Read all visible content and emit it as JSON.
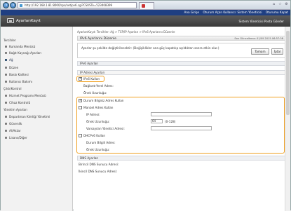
{
  "browser": {
    "url": "http://192.168.1.81:8000/rps/netipv6.cgi?CSUSTo=523408399",
    "back_icon": "back-arrow-icon",
    "forward_icon": "forward-arrow-icon"
  },
  "topmenu": {
    "items": [
      "Ana Girişe",
      "Oturum Açan Kullanıcı: Sistem Yöneticisi",
      "Oturumu Kapat"
    ]
  },
  "header": {
    "app_title": "AyarlarıKayıt",
    "portal_link": "Sistem Yöneticisi Posta Gönder"
  },
  "sidebar": {
    "sections": [
      {
        "title": "Tercihler",
        "items": [
          "Kumanda Menüsü",
          "Kağıt Kaynağı Ayarları",
          "Ağ",
          "Düzen",
          "Baskı Kalitesi",
          "Kullanıcı Bakımı"
        ]
      },
      {
        "title": "Çıktı/Kontrol",
        "items": [
          "Hizmet Programı Menüsü",
          "Cihaz Kontrolü"
        ]
      },
      {
        "title": "Yönetim Ayarları",
        "items": [
          "Departman Kimliği Yönetimi",
          "Güvenlik",
          "Al/Aktar",
          "Lisans/Diğer"
        ]
      }
    ],
    "selected": "Ağ"
  },
  "main": {
    "breadcrumb": "AyarlarıKayıt: Tercihler: Ağ > TCP/IP Ayarları > IPv6 Ayarlarını Düzenle",
    "page_title": "IPv6 Ayarlarını Düzenle",
    "last_updated": "Son Güncelleme: 01/09 2015 06:57:38",
    "message": "Ayarlar şu şekilde değiştirilecektir: (Değişiklikler ana güç kapatılıp açıldıktan sonra etkin olur.)",
    "ok_button": "Tamam",
    "cancel_button": "İptal",
    "section_ipv6": "IPv6 Ayarları",
    "section_ip_address": "IP Adresi Ayarları",
    "use_ipv6": "IPv6 Kullan",
    "link_local": "Bağlantı-Yerel Adres:",
    "prefix_length_label1": "Önek Uzunluğu:",
    "stateless": "Durum Bilgisiz Adres Kullan",
    "manual": "Manüel Adres Kullan",
    "ip_address_label": "IP Adresi:",
    "prefix_length_label": "Önek Uzunluğu:",
    "prefix_value": "64",
    "prefix_range": "(0-128)",
    "default_router": "Varsayılan Yönetici Adresi:",
    "dhcpv6": "DHCPv6 Kullan",
    "stateful": "Durum Bilgili Adres:",
    "prefix_length_label2": "Önek Uzunluğu:",
    "section_dns": "DNS Ayarları",
    "primary_dns": "Birincil DNS Sunucu Adresi:",
    "secondary_dns": "İkincil DNS Sunucu Adresi:"
  }
}
